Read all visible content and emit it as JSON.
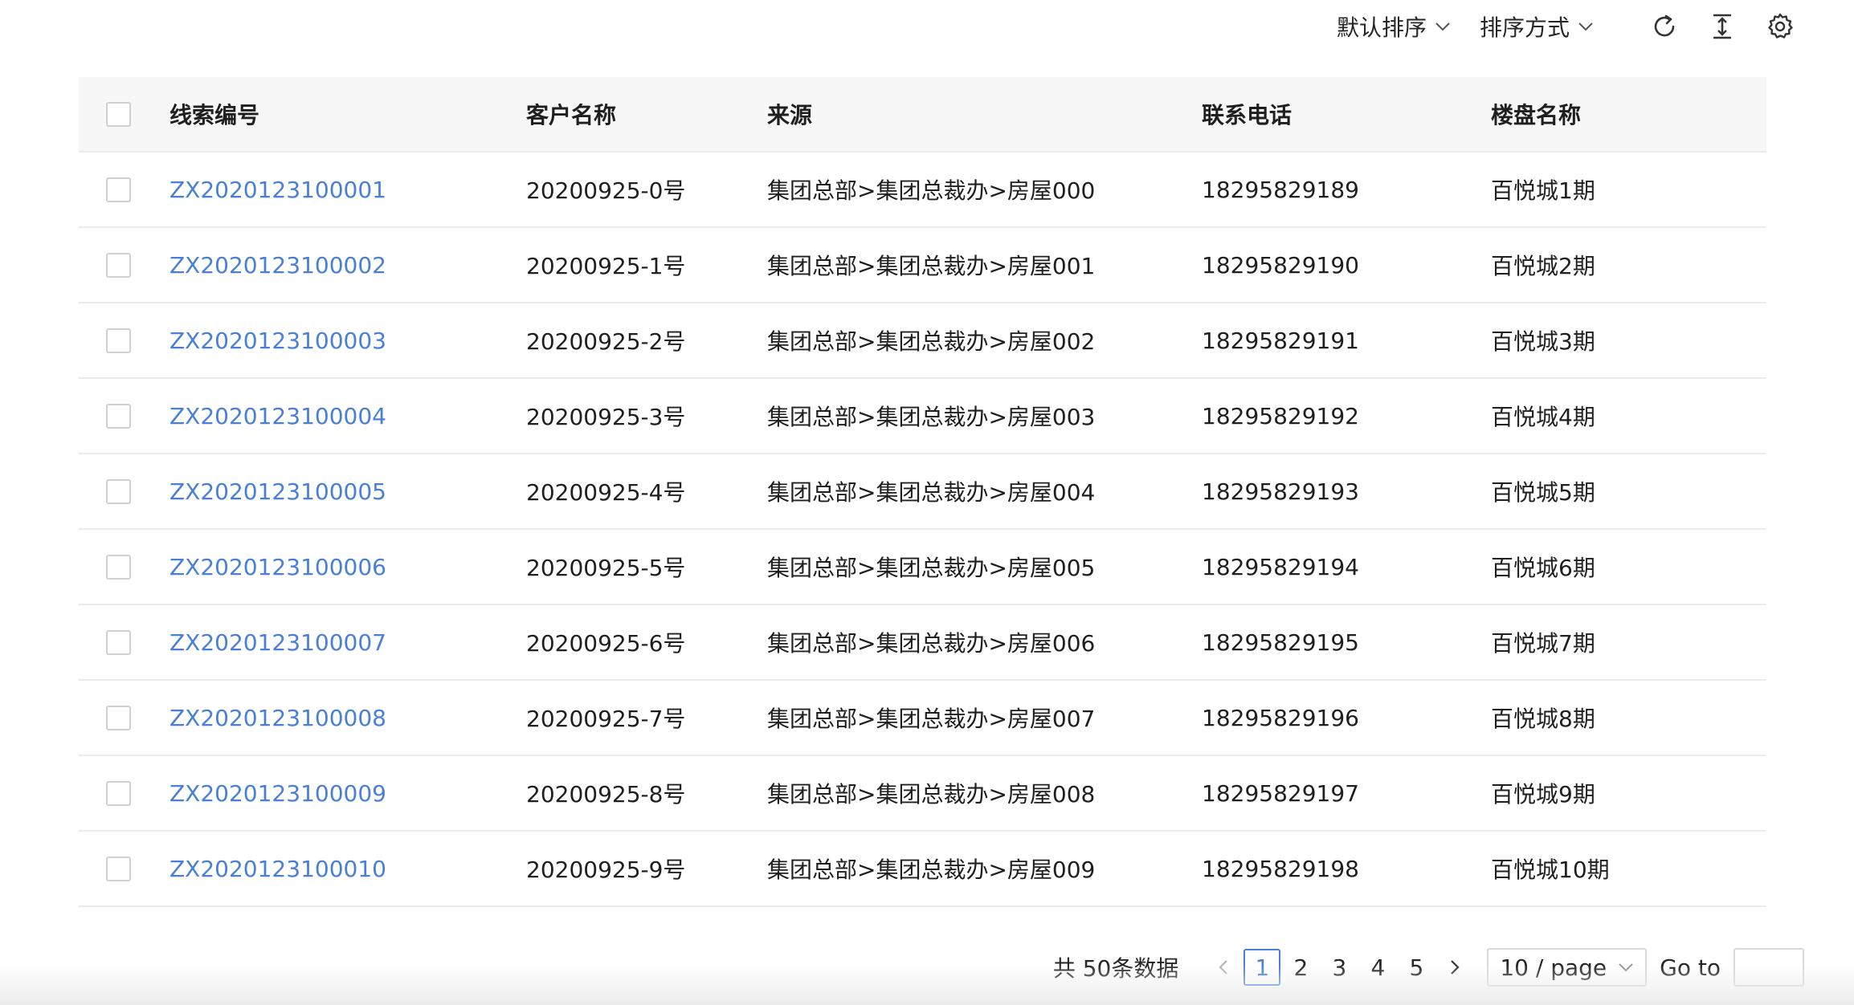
{
  "toolbar": {
    "default_sort_label": "默认排序",
    "sort_method_label": "排序方式"
  },
  "table": {
    "columns": [
      "线索编号",
      "客户名称",
      "来源",
      "联系电话",
      "楼盘名称"
    ],
    "rows": [
      {
        "id": "ZX2020123100001",
        "customer": "20200925-0号",
        "source": "集团总部>集团总裁办>房屋000",
        "phone": "18295829189",
        "estate": "百悦城1期"
      },
      {
        "id": "ZX2020123100002",
        "customer": "20200925-1号",
        "source": "集团总部>集团总裁办>房屋001",
        "phone": "18295829190",
        "estate": "百悦城2期"
      },
      {
        "id": "ZX2020123100003",
        "customer": "20200925-2号",
        "source": "集团总部>集团总裁办>房屋002",
        "phone": "18295829191",
        "estate": "百悦城3期"
      },
      {
        "id": "ZX2020123100004",
        "customer": "20200925-3号",
        "source": "集团总部>集团总裁办>房屋003",
        "phone": "18295829192",
        "estate": "百悦城4期"
      },
      {
        "id": "ZX2020123100005",
        "customer": "20200925-4号",
        "source": "集团总部>集团总裁办>房屋004",
        "phone": "18295829193",
        "estate": "百悦城5期"
      },
      {
        "id": "ZX2020123100006",
        "customer": "20200925-5号",
        "source": "集团总部>集团总裁办>房屋005",
        "phone": "18295829194",
        "estate": "百悦城6期"
      },
      {
        "id": "ZX2020123100007",
        "customer": "20200925-6号",
        "source": "集团总部>集团总裁办>房屋006",
        "phone": "18295829195",
        "estate": "百悦城7期"
      },
      {
        "id": "ZX2020123100008",
        "customer": "20200925-7号",
        "source": "集团总部>集团总裁办>房屋007",
        "phone": "18295829196",
        "estate": "百悦城8期"
      },
      {
        "id": "ZX2020123100009",
        "customer": "20200925-8号",
        "source": "集团总部>集团总裁办>房屋008",
        "phone": "18295829197",
        "estate": "百悦城9期"
      },
      {
        "id": "ZX2020123100010",
        "customer": "20200925-9号",
        "source": "集团总部>集团总裁办>房屋009",
        "phone": "18295829198",
        "estate": "百悦城10期"
      }
    ]
  },
  "pagination": {
    "total_label": "共 50条数据",
    "pages": [
      "1",
      "2",
      "3",
      "4",
      "5"
    ],
    "current_page": "1",
    "page_size": "10 / page",
    "goto_label": "Go to",
    "goto_value": ""
  },
  "colors": {
    "link": "#4a7fd8",
    "header_bg": "#f7f7f7",
    "border": "#ececec"
  }
}
